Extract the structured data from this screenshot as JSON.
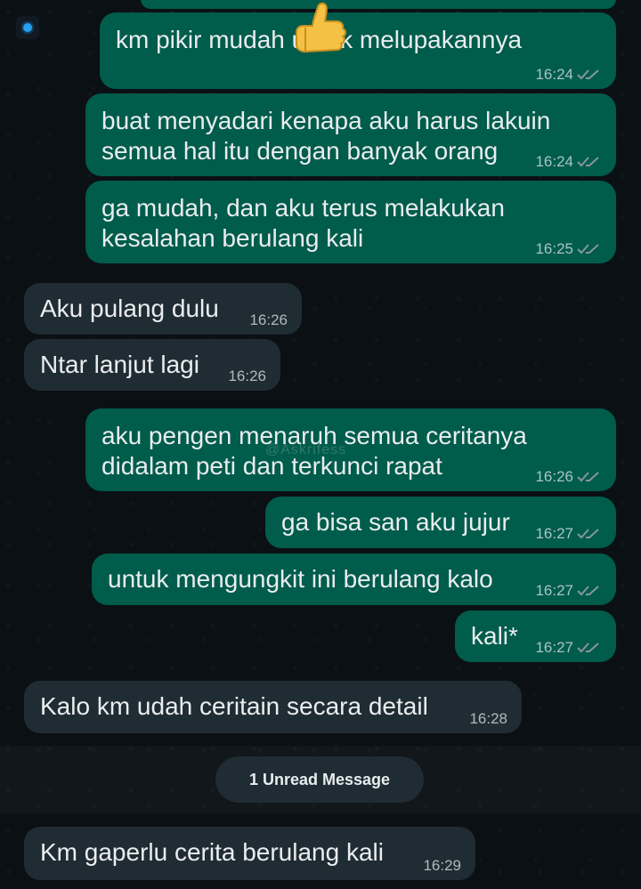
{
  "watermark": "@Askrifess",
  "unread_label": "1 Unread Message",
  "messages": [
    {
      "text": "km pikir mudah untuk melupakannya",
      "time": "16:24",
      "direction": "out",
      "read": true
    },
    {
      "text": "buat menyadari kenapa aku harus lakuin\nsemua hal itu dengan banyak orang",
      "time": "16:24",
      "direction": "out",
      "read": true
    },
    {
      "text": "ga mudah, dan aku terus melakukan\nkesalahan berulang kali",
      "time": "16:25",
      "direction": "out",
      "read": true
    },
    {
      "text": "Aku pulang dulu",
      "time": "16:26",
      "direction": "in"
    },
    {
      "text": "Ntar lanjut lagi",
      "time": "16:26",
      "direction": "in"
    },
    {
      "text": "aku pengen menaruh semua ceritanya\ndidalam peti dan terkunci rapat",
      "time": "16:26",
      "direction": "out",
      "read": true
    },
    {
      "text": "ga bisa san aku jujur",
      "time": "16:27",
      "direction": "out",
      "read": true
    },
    {
      "text": "untuk mengungkit ini berulang kalo",
      "time": "16:27",
      "direction": "out",
      "read": true
    },
    {
      "text": "kali*",
      "time": "16:27",
      "direction": "out",
      "read": true
    },
    {
      "text": "Kalo km udah ceritain secara detail",
      "time": "16:28",
      "direction": "in"
    },
    {
      "text": "Km gaperlu cerita berulang kali",
      "time": "16:29",
      "direction": "in"
    }
  ],
  "colors": {
    "outgoing_bubble": "#005c4b",
    "incoming_bubble": "#202c33",
    "background": "#0b1014",
    "read_check": "#8696a0"
  },
  "icons": {
    "thumb": "thumbs-up-icon",
    "read": "double-check-icon"
  }
}
